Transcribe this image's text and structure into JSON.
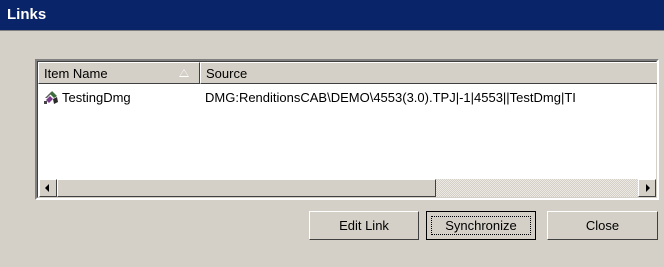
{
  "window": {
    "title": "Links"
  },
  "listview": {
    "columns": [
      "Item Name",
      "Source"
    ],
    "sort": {
      "column": "Item Name",
      "direction": "ascending"
    },
    "rows": [
      {
        "icon": "link-item-icon",
        "name": "TestingDmg",
        "source": "DMG:RenditionsCAB\\DEMO\\4553(3.0).TPJ|-1|4553||TestDmg|TI"
      }
    ],
    "scrollbar": {
      "orientation": "horizontal"
    }
  },
  "buttons": {
    "edit_link": "Edit Link",
    "synchronize": "Synchronize",
    "close": "Close"
  },
  "colors": {
    "titlebar": "#0a246a",
    "face": "#d4d0c8",
    "list_background": "#ffffff"
  }
}
